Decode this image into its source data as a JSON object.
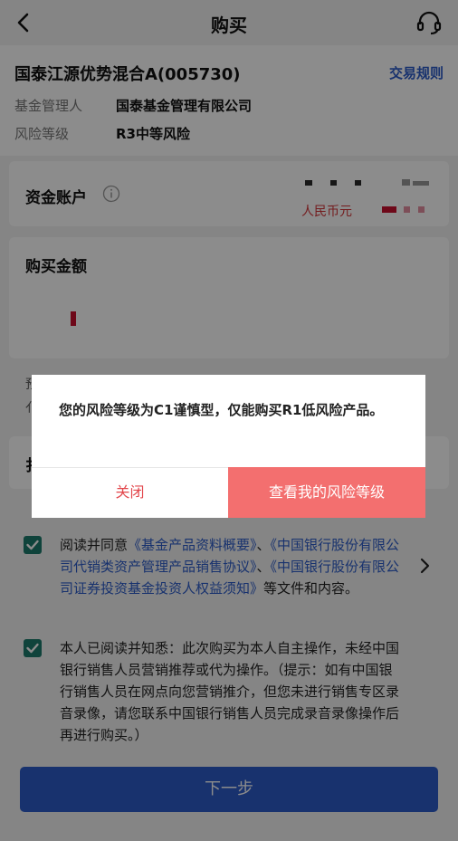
{
  "header": {
    "title": "购买",
    "back_icon": "chevron-left-icon",
    "support_icon": "headset-icon"
  },
  "fund": {
    "name": "国泰江源优势混合A(005730)",
    "trade_rule": "交易规则",
    "manager_label": "基金管理人",
    "manager_value": "国泰基金管理有限公司",
    "risk_label": "风险等级",
    "risk_value": "R3中等风险"
  },
  "account": {
    "label": "资金账户",
    "currency": "人民币元"
  },
  "amount": {
    "label": "购买金额"
  },
  "partial_text": {
    "line1": "预",
    "line2": "亻",
    "line3": "扌"
  },
  "agreements": {
    "agree1_prefix": "阅读并同意",
    "agree1_link1": "《基金产品资料概要》",
    "agree1_sep1": "、",
    "agree1_link2": "《中国银行股份有限公司代销类资产管理产品销售协议》",
    "agree1_sep2": "、",
    "agree1_link3": "《中国银行股份有限公司证券投资基金投资人权益须知》",
    "agree1_suffix": "等文件和内容。",
    "agree2_text": "本人已阅读并知悉：此次购买为本人自主操作，未经中国银行销售人员营销推荐或代为操作。（提示：如有中国银行销售人员在网点向您营销推介，但您未进行销售专区录音录像，请您联系中国银行销售人员完成录音录像操作后再进行购买。）"
  },
  "next_button": "下一步",
  "modal": {
    "message": "您的风险等级为C1谨慎型，仅能购买R1低风险产品。",
    "close": "关闭",
    "view": "查看我的风险等级"
  },
  "colors": {
    "accent_blue": "#2d5cc9",
    "checkbox_green": "#1c7a6c",
    "danger_red": "#e2464b",
    "modal_button": "#f36f6f"
  }
}
